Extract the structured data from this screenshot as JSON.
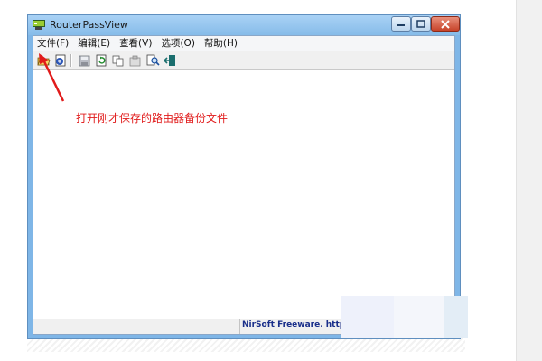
{
  "window": {
    "title": "RouterPassView"
  },
  "menu": {
    "items": [
      {
        "label": "文件(F)"
      },
      {
        "label": "编辑(E)"
      },
      {
        "label": "查看(V)"
      },
      {
        "label": "选项(O)"
      },
      {
        "label": "帮助(H)"
      }
    ]
  },
  "toolbar": {
    "buttons": [
      {
        "icon": "open-folder-icon"
      },
      {
        "icon": "decrypt-router-icon"
      },
      {
        "icon": "save-icon"
      },
      {
        "icon": "refresh-icon"
      },
      {
        "icon": "copy-icon"
      },
      {
        "icon": "properties-icon"
      },
      {
        "icon": "find-icon"
      },
      {
        "icon": "exit-icon"
      }
    ]
  },
  "statusbar": {
    "right_text": "NirSoft Freeware.  http://wv"
  },
  "annotation": {
    "text": "打开刚才保存的路由器备份文件",
    "color": "#e11b1b"
  },
  "colors": {
    "titlebar": "#86bce9",
    "close_button": "#c7432a"
  }
}
